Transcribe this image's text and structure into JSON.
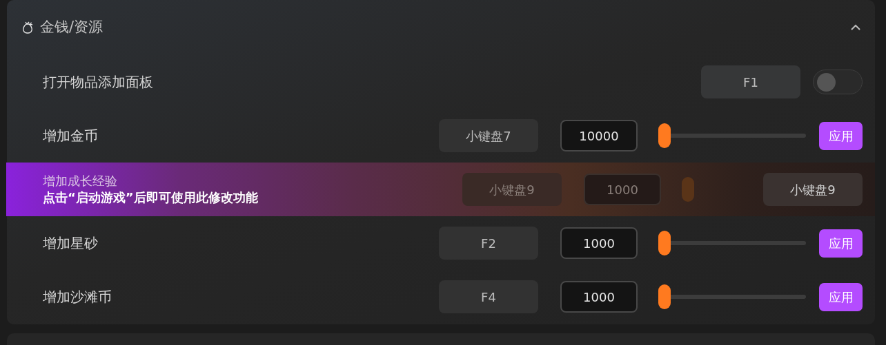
{
  "section": {
    "title": "金钱/资源",
    "expanded": true
  },
  "rows": [
    {
      "kind": "toggle",
      "label": "打开物品添加面板",
      "hotkey": "F1",
      "on": false
    },
    {
      "kind": "amount",
      "label": "增加金币",
      "hotkey": "小键盘7",
      "value": "10000",
      "level": 0,
      "apply": "应用"
    },
    {
      "kind": "locked",
      "label": "增加成长经验",
      "notice": "点击“启动游戏”后即可使用此修改功能",
      "hotkey": "小键盘9",
      "value": "1000",
      "side_hotkey": "小键盘9"
    },
    {
      "kind": "amount",
      "label": "增加星砂",
      "hotkey": "F2",
      "value": "1000",
      "level": 0,
      "apply": "应用"
    },
    {
      "kind": "amount",
      "label": "增加沙滩币",
      "hotkey": "F4",
      "value": "1000",
      "level": 0,
      "apply": "应用"
    }
  ]
}
